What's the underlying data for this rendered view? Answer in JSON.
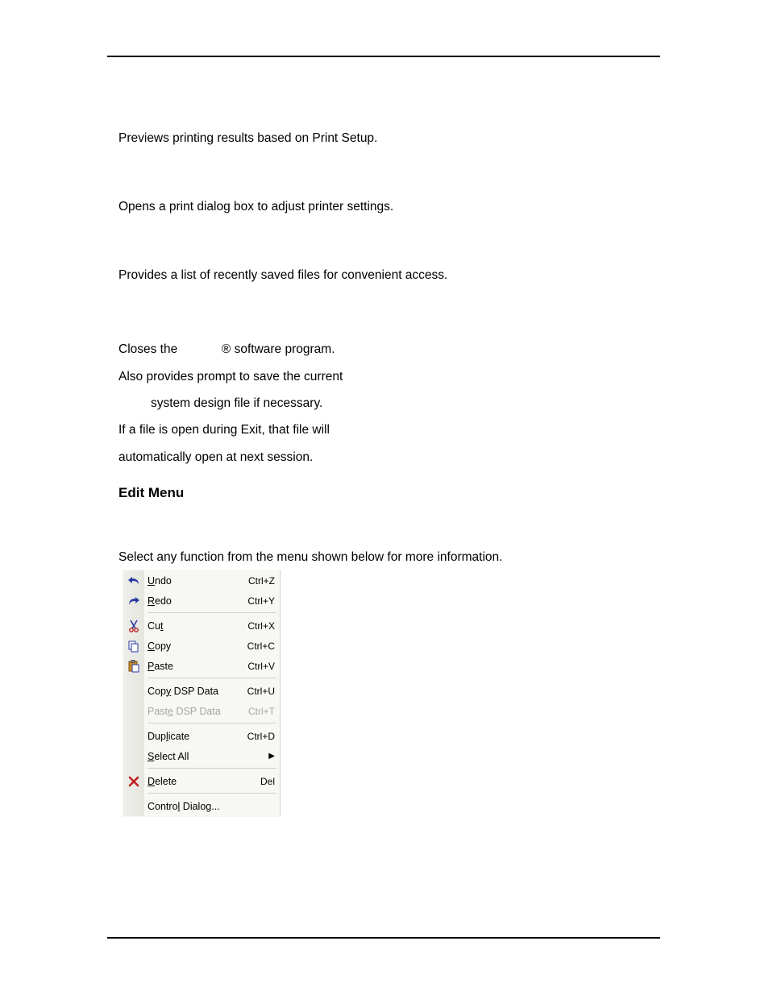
{
  "paragraphs": {
    "p1": "Previews printing results based on Print Setup.",
    "p2": "Opens a print dialog box to adjust printer settings.",
    "p3": "Provides a list of recently saved files for convenient access.",
    "exit_l1_a": "Closes the ",
    "exit_l1_b": "® software program.",
    "exit_l2": "Also provides prompt to save the current",
    "exit_l3": "system design file if necessary.",
    "exit_l4": "If a file is open during Exit, that file will",
    "exit_l5": "automatically open at next session."
  },
  "heading": "Edit Menu",
  "intro": "Select any function from the menu shown below for more information.",
  "menu": {
    "groups": [
      [
        {
          "icon": "undo-icon",
          "label_pre": "",
          "mn": "U",
          "label_post": "ndo",
          "shortcut": "Ctrl+Z"
        },
        {
          "icon": "redo-icon",
          "label_pre": "",
          "mn": "R",
          "label_post": "edo",
          "shortcut": "Ctrl+Y"
        }
      ],
      [
        {
          "icon": "cut-icon",
          "label_pre": "Cu",
          "mn": "t",
          "label_post": "",
          "shortcut": "Ctrl+X"
        },
        {
          "icon": "copy-icon",
          "label_pre": "",
          "mn": "C",
          "label_post": "opy",
          "shortcut": "Ctrl+C"
        },
        {
          "icon": "paste-icon",
          "label_pre": "",
          "mn": "P",
          "label_post": "aste",
          "shortcut": "Ctrl+V"
        }
      ],
      [
        {
          "icon": "",
          "label_pre": "Cop",
          "mn": "y",
          "label_post": " DSP Data",
          "shortcut": "Ctrl+U"
        },
        {
          "icon": "",
          "label_pre": "Past",
          "mn": "e",
          "label_post": " DSP Data",
          "shortcut": "Ctrl+T",
          "disabled": true
        }
      ],
      [
        {
          "icon": "",
          "label_pre": "Dup",
          "mn": "l",
          "label_post": "icate",
          "shortcut": "Ctrl+D"
        },
        {
          "icon": "",
          "label_pre": "",
          "mn": "S",
          "label_post": "elect All",
          "shortcut": "",
          "submenu": true
        }
      ],
      [
        {
          "icon": "delete-icon",
          "label_pre": "",
          "mn": "D",
          "label_post": "elete",
          "shortcut": "Del"
        }
      ],
      [
        {
          "icon": "",
          "label_pre": "Contro",
          "mn": "l",
          "label_post": " Dialog...",
          "shortcut": ""
        }
      ]
    ]
  }
}
